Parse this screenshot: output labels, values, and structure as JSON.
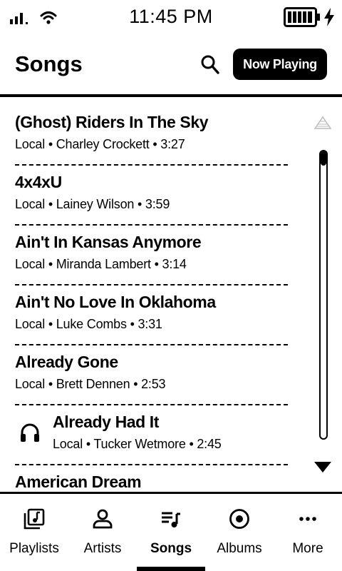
{
  "status_bar": {
    "time": "11:45 PM",
    "icons": [
      "signal-icon",
      "wifi-icon",
      "battery-icon",
      "charging-bolt-icon"
    ]
  },
  "header": {
    "title": "Songs",
    "search_icon": "search-icon",
    "now_playing_label": "Now Playing"
  },
  "songs": [
    {
      "title": "(Ghost) Riders In The Sky",
      "meta": "Local • Charley Crockett • 3:27",
      "playing": false
    },
    {
      "title": "4x4xU",
      "meta": "Local • Lainey Wilson • 3:59",
      "playing": false
    },
    {
      "title": "Ain't In Kansas Anymore",
      "meta": "Local • Miranda Lambert • 3:14",
      "playing": false
    },
    {
      "title": "Ain't No Love In Oklahoma",
      "meta": "Local • Luke Combs • 3:31",
      "playing": false
    },
    {
      "title": "Already Gone",
      "meta": "Local • Brett Dennen • 2:53",
      "playing": false
    },
    {
      "title": "Already Had It",
      "meta": "Local • Tucker Wetmore • 2:45",
      "playing": true,
      "icon": "headphones-icon"
    },
    {
      "title": "American Dream",
      "meta": "",
      "playing": false
    }
  ],
  "scrollbar": {
    "up_icon": "scroll-up-arrow-icon",
    "down_icon": "scroll-down-arrow-icon",
    "position": 0
  },
  "nav": {
    "items": [
      {
        "label": "Playlists",
        "icon": "playlist-icon",
        "active": false
      },
      {
        "label": "Artists",
        "icon": "person-icon",
        "active": false
      },
      {
        "label": "Songs",
        "icon": "songs-list-icon",
        "active": true
      },
      {
        "label": "Albums",
        "icon": "album-disc-icon",
        "active": false
      },
      {
        "label": "More",
        "icon": "more-dots-icon",
        "active": false
      }
    ]
  }
}
